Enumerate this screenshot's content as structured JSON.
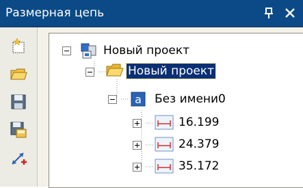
{
  "window": {
    "title": "Размерная цепь",
    "pin_glyph": "ᵼ",
    "close_glyph": "✕"
  },
  "toolbar": {
    "tools": [
      "new-project-icon",
      "open-folder-icon",
      "save-icon",
      "save-as-icon",
      "add-link-icon"
    ]
  },
  "tree": {
    "root": {
      "label": "Новый проект",
      "expander": "−"
    },
    "folder": {
      "label": "Новый проект",
      "expander": "−",
      "selected": true
    },
    "chain": {
      "label": "Без имени0",
      "expander": "−"
    },
    "dims": [
      {
        "label": "16.199",
        "expander": "+"
      },
      {
        "label": "24.379",
        "expander": "+"
      },
      {
        "label": "35.172",
        "expander": "+"
      }
    ]
  }
}
